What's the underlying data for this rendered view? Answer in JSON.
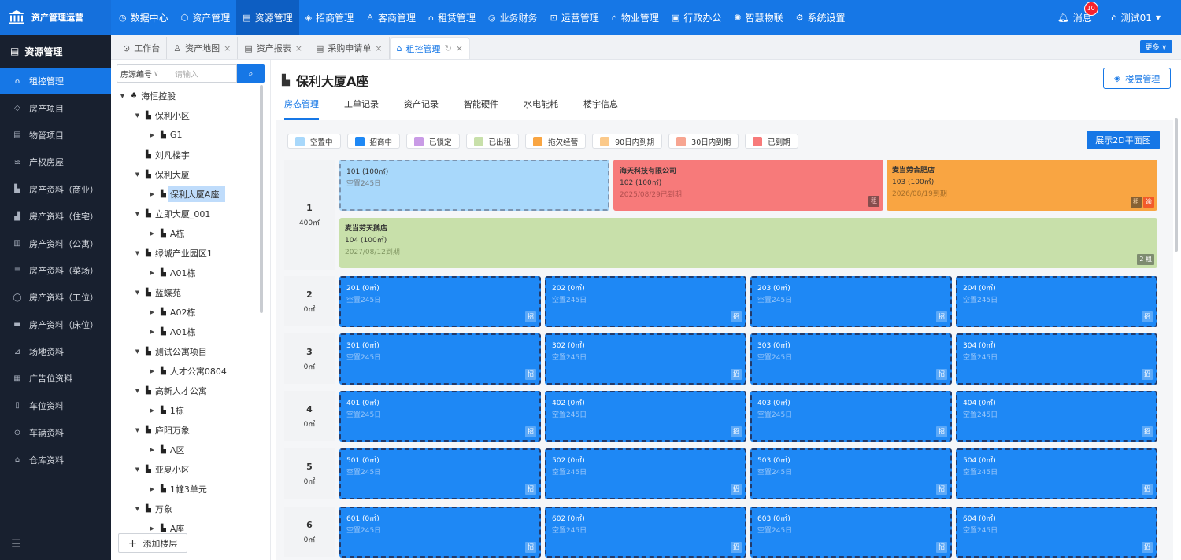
{
  "app": {
    "title": "资产管理运营"
  },
  "nav": [
    {
      "icon": "◷",
      "label": "数据中心"
    },
    {
      "icon": "⬡",
      "label": "资产管理"
    },
    {
      "icon": "▤",
      "label": "资源管理"
    },
    {
      "icon": "◈",
      "label": "招商管理"
    },
    {
      "icon": "♙",
      "label": "客商管理"
    },
    {
      "icon": "⌂",
      "label": "租赁管理"
    },
    {
      "icon": "◎",
      "label": "业务财务"
    },
    {
      "icon": "⊡",
      "label": "运营管理"
    },
    {
      "icon": "⌂",
      "label": "物业管理"
    },
    {
      "icon": "▣",
      "label": "行政办公"
    },
    {
      "icon": "✺",
      "label": "智慧物联"
    },
    {
      "icon": "⚙",
      "label": "系统设置"
    }
  ],
  "header": {
    "messages_label": "消息",
    "messages_count": "10",
    "user": "测试01"
  },
  "sidebar": {
    "title": "资源管理",
    "items": [
      {
        "icon": "⌂",
        "label": "租控管理"
      },
      {
        "icon": "◇",
        "label": "房产项目"
      },
      {
        "icon": "▤",
        "label": "物管项目"
      },
      {
        "icon": "≋",
        "label": "产权房屋"
      },
      {
        "icon": "▙",
        "label": "房产资料（商业）"
      },
      {
        "icon": "▟",
        "label": "房产资料（住宅）"
      },
      {
        "icon": "▥",
        "label": "房产资料（公寓）"
      },
      {
        "icon": "≡",
        "label": "房产资料（菜场）"
      },
      {
        "icon": "◯",
        "label": "房产资料（工位）"
      },
      {
        "icon": "▬",
        "label": "房产资料（床位）"
      },
      {
        "icon": "⊿",
        "label": "场地资料"
      },
      {
        "icon": "▦",
        "label": "广告位资料"
      },
      {
        "icon": "▯",
        "label": "车位资料"
      },
      {
        "icon": "⊙",
        "label": "车辆资料"
      },
      {
        "icon": "⌂",
        "label": "仓库资料"
      }
    ]
  },
  "tabs": [
    {
      "label": "工作台",
      "icon": "⊙",
      "closable": false
    },
    {
      "label": "资产地图",
      "icon": "♙",
      "closable": true
    },
    {
      "label": "资产报表",
      "icon": "▤",
      "closable": true
    },
    {
      "label": "采购申请单",
      "icon": "▤",
      "closable": true
    },
    {
      "label": "租控管理",
      "icon": "⌂",
      "closable": true
    }
  ],
  "tabbar": {
    "more_label": "更多 ∨"
  },
  "tree_search": {
    "select_label": "房源编号",
    "placeholder": "请输入"
  },
  "tree": [
    {
      "label": "海恒控股",
      "level": 0,
      "arrow": "▼"
    },
    {
      "label": "保利小区",
      "level": 1,
      "arrow": "▼"
    },
    {
      "label": "G1",
      "level": 2,
      "arrow": "▶"
    },
    {
      "label": "刘凡楼宇",
      "level": 1,
      "arrow": ""
    },
    {
      "label": "保利大厦",
      "level": 1,
      "arrow": "▼"
    },
    {
      "label": "保利大厦A座",
      "level": 2,
      "arrow": "▶",
      "selected": true
    },
    {
      "label": "立即大厦_001",
      "level": 1,
      "arrow": "▼"
    },
    {
      "label": "A栋",
      "level": 2,
      "arrow": "▶"
    },
    {
      "label": "绿城产业园区1",
      "level": 1,
      "arrow": "▼"
    },
    {
      "label": "A01栋",
      "level": 2,
      "arrow": "▶"
    },
    {
      "label": "蓝蝶苑",
      "level": 1,
      "arrow": "▼"
    },
    {
      "label": "A02栋",
      "level": 2,
      "arrow": "▶"
    },
    {
      "label": "A01栋",
      "level": 2,
      "arrow": "▶"
    },
    {
      "label": "测试公寓项目",
      "level": 1,
      "arrow": "▼"
    },
    {
      "label": "人才公寓0804",
      "level": 2,
      "arrow": "▶"
    },
    {
      "label": "高新人才公寓",
      "level": 1,
      "arrow": "▼"
    },
    {
      "label": "1栋",
      "level": 2,
      "arrow": "▶"
    },
    {
      "label": "庐阳万象",
      "level": 1,
      "arrow": "▼"
    },
    {
      "label": "A区",
      "level": 2,
      "arrow": "▶"
    },
    {
      "label": "亚夏小区",
      "level": 1,
      "arrow": "▼"
    },
    {
      "label": "1幢3单元",
      "level": 2,
      "arrow": "▶"
    },
    {
      "label": "万象",
      "level": 1,
      "arrow": "▼"
    },
    {
      "label": "A座",
      "level": 2,
      "arrow": "▶"
    }
  ],
  "tree_add_label": "添加楼层",
  "page": {
    "title": "保利大厦A座",
    "floor_mgr_label": "楼层管理",
    "show2d_label": "展示2D平面图"
  },
  "subtabs": [
    "房态管理",
    "工单记录",
    "资产记录",
    "智能硬件",
    "水电能耗",
    "楼宇信息"
  ],
  "legend": [
    {
      "label": "空置中",
      "color": "#a8d8fb"
    },
    {
      "label": "招商中",
      "color": "#1e88f5"
    },
    {
      "label": "已锁定",
      "color": "#c99be6"
    },
    {
      "label": "已出租",
      "color": "#c8e0aa"
    },
    {
      "label": "拖欠经营",
      "color": "#f9a542"
    },
    {
      "label": "90日内到期",
      "color": "#fbc98a"
    },
    {
      "label": "30日内到期",
      "color": "#f7a591"
    },
    {
      "label": "已到期",
      "color": "#f77a7a"
    }
  ],
  "floors": [
    {
      "num": "1",
      "area": "400㎡"
    },
    {
      "num": "2",
      "area": "0㎡"
    },
    {
      "num": "3",
      "area": "0㎡"
    },
    {
      "num": "4",
      "area": "0㎡"
    },
    {
      "num": "5",
      "area": "0㎡"
    },
    {
      "num": "6",
      "area": "0㎡"
    }
  ],
  "floor1_rooms": [
    {
      "line1": "101 (100㎡)",
      "line2": "空置245日",
      "line3": "",
      "status": "vacant",
      "tags": []
    },
    {
      "line1": "海天科技有限公司",
      "line2": "102 (100㎡)",
      "line3": "2025/08/29已到期",
      "status": "expired",
      "tags": [
        "租"
      ]
    },
    {
      "line1": "麦当劳合肥店",
      "line2": "103 (100㎡)",
      "line3": "2026/08/19到期",
      "status": "overdue",
      "tags": [
        "租",
        "逾"
      ]
    },
    {
      "line1": "麦当劳天鹅店",
      "line2": "104 (100㎡)",
      "line3": "2027/08/12到期",
      "status": "rented",
      "tags": [
        "2 租"
      ]
    }
  ],
  "upper_rooms": {
    "2": [
      "201 (0㎡)",
      "202 (0㎡)",
      "203 (0㎡)",
      "204 (0㎡)"
    ],
    "3": [
      "301 (0㎡)",
      "302 (0㎡)",
      "303 (0㎡)",
      "304 (0㎡)"
    ],
    "4": [
      "401 (0㎡)",
      "402 (0㎡)",
      "403 (0㎡)",
      "404 (0㎡)"
    ],
    "5": [
      "501 (0㎡)",
      "502 (0㎡)",
      "503 (0㎡)",
      "504 (0㎡)"
    ],
    "6": [
      "601 (0㎡)",
      "602 (0㎡)",
      "603 (0㎡)",
      "604 (0㎡)"
    ]
  },
  "upper_room_sub": "空置245日",
  "upper_room_tag": "招"
}
